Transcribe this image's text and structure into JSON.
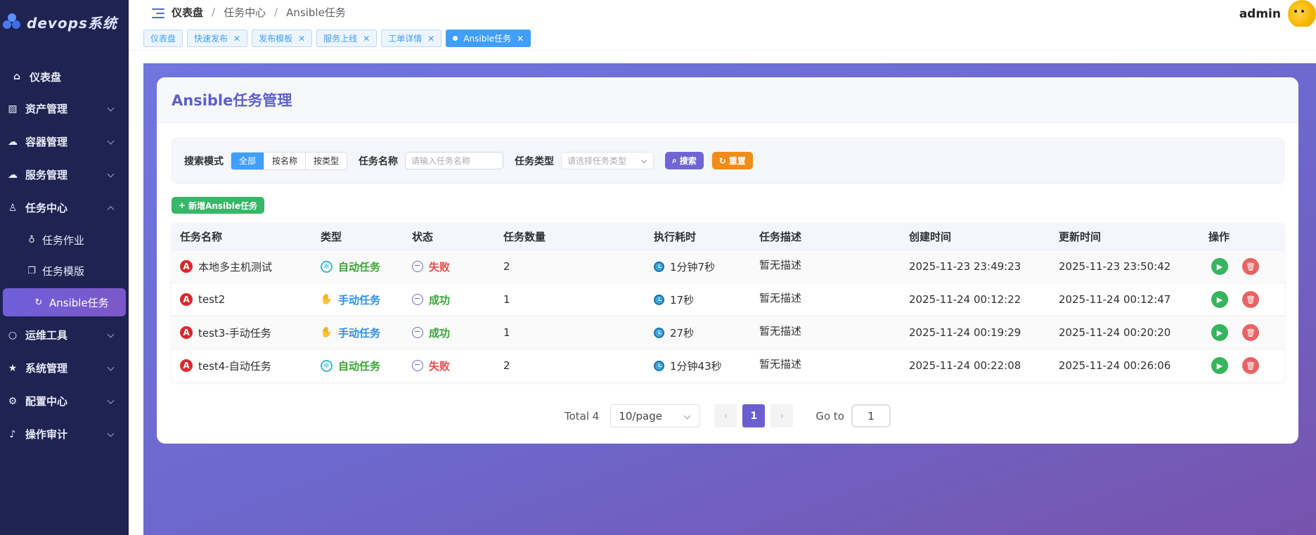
{
  "sidebar": {
    "logo_text": "devops系统",
    "items": [
      {
        "label": "仪表盘"
      },
      {
        "label": "资产管理"
      },
      {
        "label": "容器管理"
      },
      {
        "label": "服务管理"
      },
      {
        "label": "任务中心"
      },
      {
        "label": "运维工具"
      },
      {
        "label": "系统管理"
      },
      {
        "label": "配置中心"
      },
      {
        "label": "操作审计"
      }
    ],
    "task_sub": [
      {
        "label": "任务作业"
      },
      {
        "label": "任务模版"
      },
      {
        "label": "Ansible任务",
        "active": true
      }
    ]
  },
  "header": {
    "breadcrumb": [
      "仪表盘",
      "任务中心",
      "Ansible任务"
    ],
    "username": "admin"
  },
  "tags": [
    {
      "label": "仪表盘",
      "closable": false
    },
    {
      "label": "快速发布",
      "closable": true
    },
    {
      "label": "发布模板",
      "closable": true
    },
    {
      "label": "服务上线",
      "closable": true
    },
    {
      "label": "工单详情",
      "closable": true
    },
    {
      "label": "Ansible任务",
      "closable": true,
      "active": true
    }
  ],
  "page": {
    "title": "Ansible任务管理",
    "filter": {
      "mode_label": "搜索模式",
      "modes": [
        "全部",
        "按名称",
        "按类型"
      ],
      "active_mode": "全部",
      "name_label": "任务名称",
      "name_placeholder": "请输入任务名称",
      "type_label": "任务类型",
      "type_placeholder": "请选择任务类型",
      "search_btn": "搜索",
      "reset_btn": "重置"
    },
    "add_btn": "新增Ansible任务"
  },
  "table": {
    "columns": [
      "任务名称",
      "类型",
      "状态",
      "任务数量",
      "执行耗时",
      "任务描述",
      "创建时间",
      "更新时间",
      "操作"
    ],
    "rows": [
      {
        "name": "本地多主机测试",
        "type": "自动任务",
        "type_kind": "auto",
        "status": "失败",
        "status_kind": "fail",
        "count": "2",
        "duration": "1分钟7秒",
        "desc": "暂无描述",
        "created": "2025-11-23 23:49:23",
        "updated": "2025-11-23 23:50:42"
      },
      {
        "name": "test2",
        "type": "手动任务",
        "type_kind": "manual",
        "status": "成功",
        "status_kind": "ok",
        "count": "1",
        "duration": "17秒",
        "desc": "暂无描述",
        "created": "2025-11-24 00:12:22",
        "updated": "2025-11-24 00:12:47"
      },
      {
        "name": "test3-手动任务",
        "type": "手动任务",
        "type_kind": "manual",
        "status": "成功",
        "status_kind": "ok",
        "count": "1",
        "duration": "27秒",
        "desc": "暂无描述",
        "created": "2025-11-24 00:19:29",
        "updated": "2025-11-24 00:20:20"
      },
      {
        "name": "test4-自动任务",
        "type": "自动任务",
        "type_kind": "auto",
        "status": "失败",
        "status_kind": "fail",
        "count": "2",
        "duration": "1分钟43秒",
        "desc": "暂无描述",
        "created": "2025-11-24 00:22:08",
        "updated": "2025-11-24 00:26:06"
      }
    ]
  },
  "pagination": {
    "total": "Total 4",
    "page_size": "10/page",
    "current": "1",
    "goto_label": "Go to",
    "goto_value": "1"
  },
  "colors": {
    "sidebar_bg": "#1e2351",
    "accent": "#6b5fd0",
    "primary": "#409eff",
    "success": "#3aa634",
    "danger": "#e64a4a",
    "warning": "#ef8c1a"
  }
}
